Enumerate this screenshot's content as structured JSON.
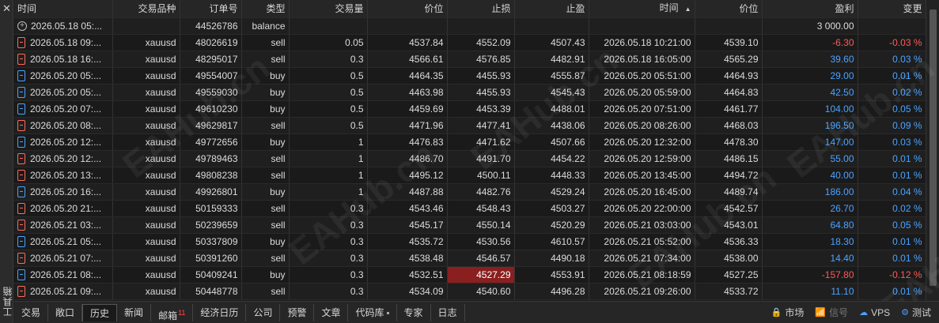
{
  "window": {
    "side_label": "工具箱"
  },
  "columns": [
    "时间",
    "交易品种",
    "订单号",
    "类型",
    "交易量",
    "价位",
    "止损",
    "止盈",
    "时间",
    "价位",
    "盈利",
    "变更"
  ],
  "balance_row": {
    "time": "2026.05.18 05:...",
    "order": "44526786",
    "type": "balance",
    "profit": "3 000.00"
  },
  "rows": [
    {
      "time": "2026.05.18 09:...",
      "symbol": "xauusd",
      "order": "48026619",
      "type": "sell",
      "volume": "0.05",
      "price": "4537.84",
      "sl": "4552.09",
      "tp": "4507.43",
      "close_time": "2026.05.18 10:21:00",
      "close_price": "4539.10",
      "profit": "-6.30",
      "change": "-0.03 %"
    },
    {
      "time": "2026.05.18 16:...",
      "symbol": "xauusd",
      "order": "48295017",
      "type": "sell",
      "volume": "0.3",
      "price": "4566.61",
      "sl": "4576.85",
      "tp": "4482.91",
      "close_time": "2026.05.18 16:05:00",
      "close_price": "4565.29",
      "profit": "39.60",
      "change": "0.03 %"
    },
    {
      "time": "2026.05.20 05:...",
      "symbol": "xauusd",
      "order": "49554007",
      "type": "buy",
      "volume": "0.5",
      "price": "4464.35",
      "sl": "4455.93",
      "tp": "4555.87",
      "close_time": "2026.05.20 05:51:00",
      "close_price": "4464.93",
      "profit": "29.00",
      "change": "0.01 %"
    },
    {
      "time": "2026.05.20 05:...",
      "symbol": "xauusd",
      "order": "49559030",
      "type": "buy",
      "volume": "0.5",
      "price": "4463.98",
      "sl": "4455.93",
      "tp": "4545.43",
      "close_time": "2026.05.20 05:59:00",
      "close_price": "4464.83",
      "profit": "42.50",
      "change": "0.02 %"
    },
    {
      "time": "2026.05.20 07:...",
      "symbol": "xauusd",
      "order": "49610230",
      "type": "buy",
      "volume": "0.5",
      "price": "4459.69",
      "sl": "4453.39",
      "tp": "4488.01",
      "close_time": "2026.05.20 07:51:00",
      "close_price": "4461.77",
      "profit": "104.00",
      "change": "0.05 %"
    },
    {
      "time": "2026.05.20 08:...",
      "symbol": "xauusd",
      "order": "49629817",
      "type": "sell",
      "volume": "0.5",
      "price": "4471.96",
      "sl": "4477.41",
      "tp": "4438.06",
      "close_time": "2026.05.20 08:26:00",
      "close_price": "4468.03",
      "profit": "196.50",
      "change": "0.09 %"
    },
    {
      "time": "2026.05.20 12:...",
      "symbol": "xauusd",
      "order": "49772656",
      "type": "buy",
      "volume": "1",
      "price": "4476.83",
      "sl": "4471.62",
      "tp": "4507.66",
      "close_time": "2026.05.20 12:32:00",
      "close_price": "4478.30",
      "profit": "147.00",
      "change": "0.03 %"
    },
    {
      "time": "2026.05.20 12:...",
      "symbol": "xauusd",
      "order": "49789463",
      "type": "sell",
      "volume": "1",
      "price": "4486.70",
      "sl": "4491.70",
      "tp": "4454.22",
      "close_time": "2026.05.20 12:59:00",
      "close_price": "4486.15",
      "profit": "55.00",
      "change": "0.01 %"
    },
    {
      "time": "2026.05.20 13:...",
      "symbol": "xauusd",
      "order": "49808238",
      "type": "sell",
      "volume": "1",
      "price": "4495.12",
      "sl": "4500.11",
      "tp": "4448.33",
      "close_time": "2026.05.20 13:45:00",
      "close_price": "4494.72",
      "profit": "40.00",
      "change": "0.01 %"
    },
    {
      "time": "2026.05.20 16:...",
      "symbol": "xauusd",
      "order": "49926801",
      "type": "buy",
      "volume": "1",
      "price": "4487.88",
      "sl": "4482.76",
      "tp": "4529.24",
      "close_time": "2026.05.20 16:45:00",
      "close_price": "4489.74",
      "profit": "186.00",
      "change": "0.04 %"
    },
    {
      "time": "2026.05.20 21:...",
      "symbol": "xauusd",
      "order": "50159333",
      "type": "sell",
      "volume": "0.3",
      "price": "4543.46",
      "sl": "4548.43",
      "tp": "4503.27",
      "close_time": "2026.05.20 22:00:00",
      "close_price": "4542.57",
      "profit": "26.70",
      "change": "0.02 %"
    },
    {
      "time": "2026.05.21 03:...",
      "symbol": "xauusd",
      "order": "50239659",
      "type": "sell",
      "volume": "0.3",
      "price": "4545.17",
      "sl": "4550.14",
      "tp": "4520.29",
      "close_time": "2026.05.21 03:03:00",
      "close_price": "4543.01",
      "profit": "64.80",
      "change": "0.05 %"
    },
    {
      "time": "2026.05.21 05:...",
      "symbol": "xauusd",
      "order": "50337809",
      "type": "buy",
      "volume": "0.3",
      "price": "4535.72",
      "sl": "4530.56",
      "tp": "4610.57",
      "close_time": "2026.05.21 05:52:00",
      "close_price": "4536.33",
      "profit": "18.30",
      "change": "0.01 %"
    },
    {
      "time": "2026.05.21 07:...",
      "symbol": "xauusd",
      "order": "50391260",
      "type": "sell",
      "volume": "0.3",
      "price": "4538.48",
      "sl": "4546.57",
      "tp": "4490.18",
      "close_time": "2026.05.21 07:34:00",
      "close_price": "4538.00",
      "profit": "14.40",
      "change": "0.01 %"
    },
    {
      "time": "2026.05.21 08:...",
      "symbol": "xauusd",
      "order": "50409241",
      "type": "buy",
      "volume": "0.3",
      "price": "4532.51",
      "sl": "4527.29",
      "tp": "4553.91",
      "close_time": "2026.05.21 08:18:59",
      "close_price": "4527.25",
      "profit": "-157.80",
      "change": "-0.12 %",
      "sl_hit": true
    },
    {
      "time": "2026.05.21 09:...",
      "symbol": "xauusd",
      "order": "50448778",
      "type": "sell",
      "volume": "0.3",
      "price": "4534.09",
      "sl": "4540.60",
      "tp": "4496.28",
      "close_time": "2026.05.21 09:26:00",
      "close_price": "4533.72",
      "profit": "11.10",
      "change": "0.01 %"
    }
  ],
  "tabs": [
    {
      "label": "交易"
    },
    {
      "label": "敞口"
    },
    {
      "label": "历史",
      "active": true
    },
    {
      "label": "新闻"
    },
    {
      "label": "邮箱",
      "badge": "11"
    },
    {
      "label": "经济日历"
    },
    {
      "label": "公司"
    },
    {
      "label": "预警"
    },
    {
      "label": "文章"
    },
    {
      "label": "代码库",
      "dot": true
    },
    {
      "label": "专家"
    },
    {
      "label": "日志"
    }
  ],
  "status": [
    {
      "icon": "market-icon",
      "label": "市场"
    },
    {
      "icon": "signal-icon",
      "label": "信号",
      "dim": true
    },
    {
      "icon": "vps-icon",
      "label": "VPS"
    },
    {
      "icon": "test-icon",
      "label": "测试"
    }
  ],
  "watermarks": [
    "EAHub.cn",
    "EAHub.cn",
    "EAHub.cn",
    "EAHub.cn",
    "EAHub.cn",
    "EAHub.cn"
  ]
}
